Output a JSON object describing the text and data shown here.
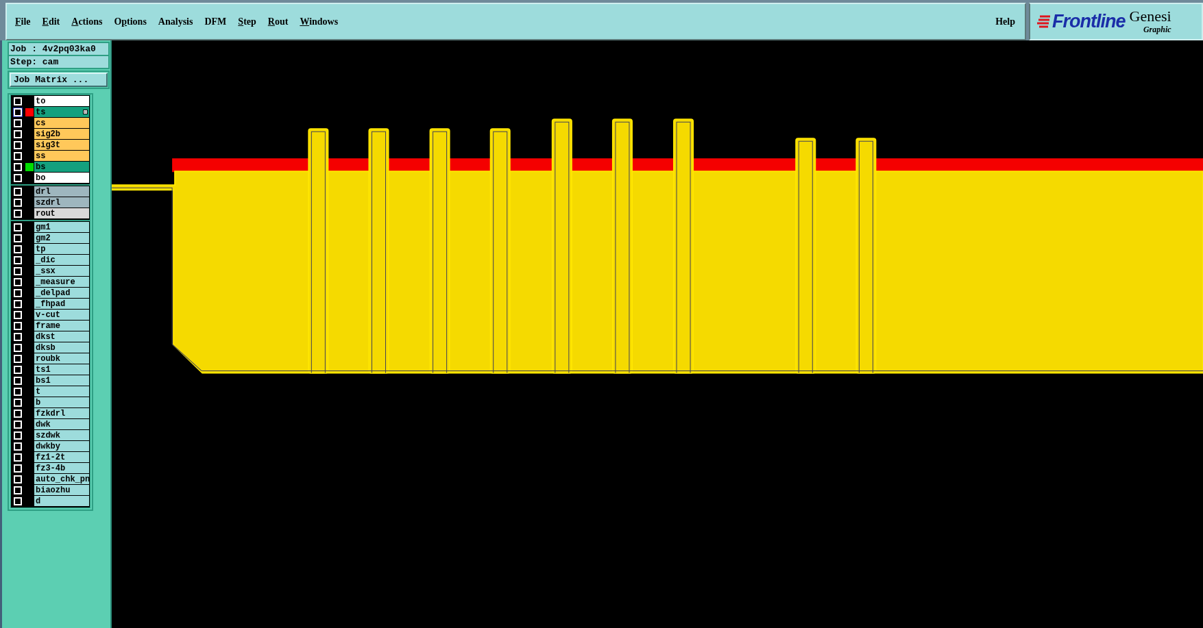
{
  "menu_bar": {
    "menus": [
      {
        "mnemonic": "F",
        "after": "ile"
      },
      {
        "mnemonic": "E",
        "after": "dit"
      },
      {
        "mnemonic": "A",
        "after": "ctions"
      },
      {
        "before": "O",
        "mnemonic": "p",
        "after": "tions"
      },
      {
        "before": "Analysis"
      },
      {
        "before": "DFM"
      },
      {
        "mnemonic": "S",
        "after": "tep"
      },
      {
        "mnemonic": "R",
        "after": "out"
      },
      {
        "mnemonic": "W",
        "after": "indows"
      }
    ],
    "help": "Help"
  },
  "logo": {
    "brand": "Frontline",
    "product": "Genesi",
    "subtitle": "Graphic"
  },
  "job_info": {
    "job": "Job : 4v2pq03ka0",
    "step": "Step: cam",
    "matrix_button": "Job Matrix ..."
  },
  "layer_groups": [
    {
      "layers": [
        {
          "name": "to",
          "color": "#ffffff",
          "checked": false,
          "selected": false
        },
        {
          "name": "ts",
          "color": "#14a07e",
          "checked": false,
          "selected": true,
          "work_layer": true
        },
        {
          "name": "cs",
          "color": "#ffc85a",
          "checked": false,
          "selected": false
        },
        {
          "name": "sig2b",
          "color": "#ffc85a",
          "checked": false,
          "selected": false
        },
        {
          "name": "sig3t",
          "color": "#ffc85a",
          "checked": false,
          "selected": false
        },
        {
          "name": "ss",
          "color": "#ffc85a",
          "checked": false,
          "selected": false
        },
        {
          "name": "bs",
          "color": "#14a07e",
          "checked": false,
          "selected": false,
          "affected": true
        },
        {
          "name": "bo",
          "color": "#ffffff",
          "checked": false,
          "selected": false
        }
      ]
    },
    {
      "layers": [
        {
          "name": "drl",
          "color": "#9eb6be",
          "checked": false,
          "selected": false
        },
        {
          "name": "szdrl",
          "color": "#9eb6be",
          "checked": false,
          "selected": false
        },
        {
          "name": "rout",
          "color": "#d9d9d9",
          "checked": false,
          "selected": false
        }
      ]
    },
    {
      "layers": [
        {
          "name": "gm1",
          "color": "#9ddcdc",
          "checked": false,
          "selected": false
        },
        {
          "name": "gm2",
          "color": "#9ddcdc",
          "checked": false,
          "selected": false
        },
        {
          "name": "tp",
          "color": "#9ddcdc",
          "checked": false,
          "selected": false
        },
        {
          "name": "_dic",
          "color": "#9ddcdc",
          "checked": false,
          "selected": false
        },
        {
          "name": "_ssx",
          "color": "#9ddcdc",
          "checked": false,
          "selected": false
        },
        {
          "name": "_measure",
          "color": "#9ddcdc",
          "checked": false,
          "selected": false
        },
        {
          "name": "_delpad",
          "color": "#9ddcdc",
          "checked": false,
          "selected": false
        },
        {
          "name": "_fhpad",
          "color": "#9ddcdc",
          "checked": false,
          "selected": false
        },
        {
          "name": "v-cut",
          "color": "#9ddcdc",
          "checked": false,
          "selected": false
        },
        {
          "name": "frame",
          "color": "#9ddcdc",
          "checked": false,
          "selected": false
        },
        {
          "name": "dkst",
          "color": "#9ddcdc",
          "checked": false,
          "selected": false
        },
        {
          "name": "dksb",
          "color": "#9ddcdc",
          "checked": false,
          "selected": false
        },
        {
          "name": "roubk",
          "color": "#9ddcdc",
          "checked": false,
          "selected": false
        },
        {
          "name": "ts1",
          "color": "#9ddcdc",
          "checked": false,
          "selected": false
        },
        {
          "name": "bs1",
          "color": "#9ddcdc",
          "checked": false,
          "selected": false
        },
        {
          "name": "t",
          "color": "#9ddcdc",
          "checked": false,
          "selected": false
        },
        {
          "name": "b",
          "color": "#9ddcdc",
          "checked": false,
          "selected": false
        },
        {
          "name": "fzkdrl",
          "color": "#9ddcdc",
          "checked": false,
          "selected": false
        },
        {
          "name": "dwk",
          "color": "#9ddcdc",
          "checked": false,
          "selected": false
        },
        {
          "name": "szdwk",
          "color": "#9ddcdc",
          "checked": false,
          "selected": false
        },
        {
          "name": "dwkby",
          "color": "#9ddcdc",
          "checked": false,
          "selected": false
        },
        {
          "name": "fz1-2t",
          "color": "#9ddcdc",
          "checked": false,
          "selected": false
        },
        {
          "name": "fz3-4b",
          "color": "#9ddcdc",
          "checked": false,
          "selected": false
        },
        {
          "name": "auto_chk_pn",
          "color": "#9ddcdc",
          "checked": false,
          "selected": false
        },
        {
          "name": "biaozhu",
          "color": "#9ddcdc",
          "checked": false,
          "selected": false
        },
        {
          "name": "d",
          "color": "#9ddcdc",
          "checked": false,
          "selected": false
        }
      ]
    }
  ]
}
